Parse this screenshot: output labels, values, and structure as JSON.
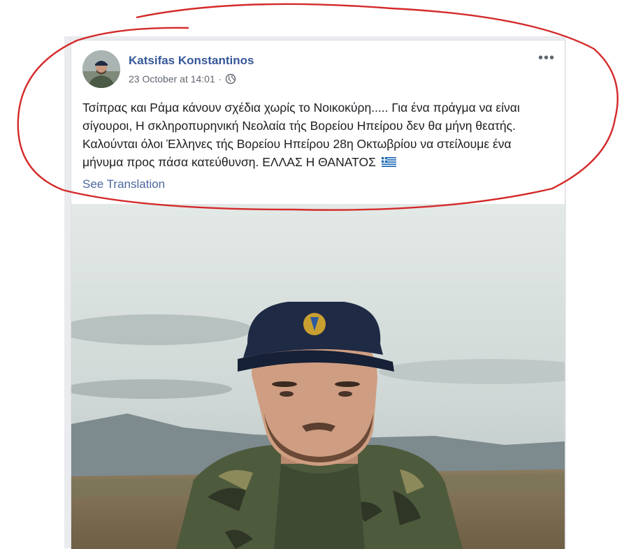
{
  "post": {
    "author": "Katsifas Konstantinos",
    "timestamp": "23 October at 14:01",
    "separator": "·",
    "privacy_icon": "globe-icon",
    "more_icon": "•••",
    "text": "Τσίπρας και Ράμα κάνουν σχέδια χωρίς το Νοικοκύρη..... Για ένα πράγμα να είναι σίγουροι, Η σκληροπυρηνική Νεολαία τής Βορείου Ηπείρου δεν θα μήνη θεατής. Καλούνται όλοι Έλληνες τής Βορείου Ηπείρου 28η Οκτωβρίου να στείλουμε ένα μήνυμα προς πάσα κατεύθυνση. ΕΛΛΑΣ Η ΘΑΝΑΤΟΣ",
    "flag_icon": "greek-flag-emoji",
    "see_translation": "See Translation"
  },
  "colors": {
    "author_link": "#365899",
    "meta_text": "#616770",
    "body_text": "#1c1e21",
    "annotation_circle": "#d42a2a"
  }
}
